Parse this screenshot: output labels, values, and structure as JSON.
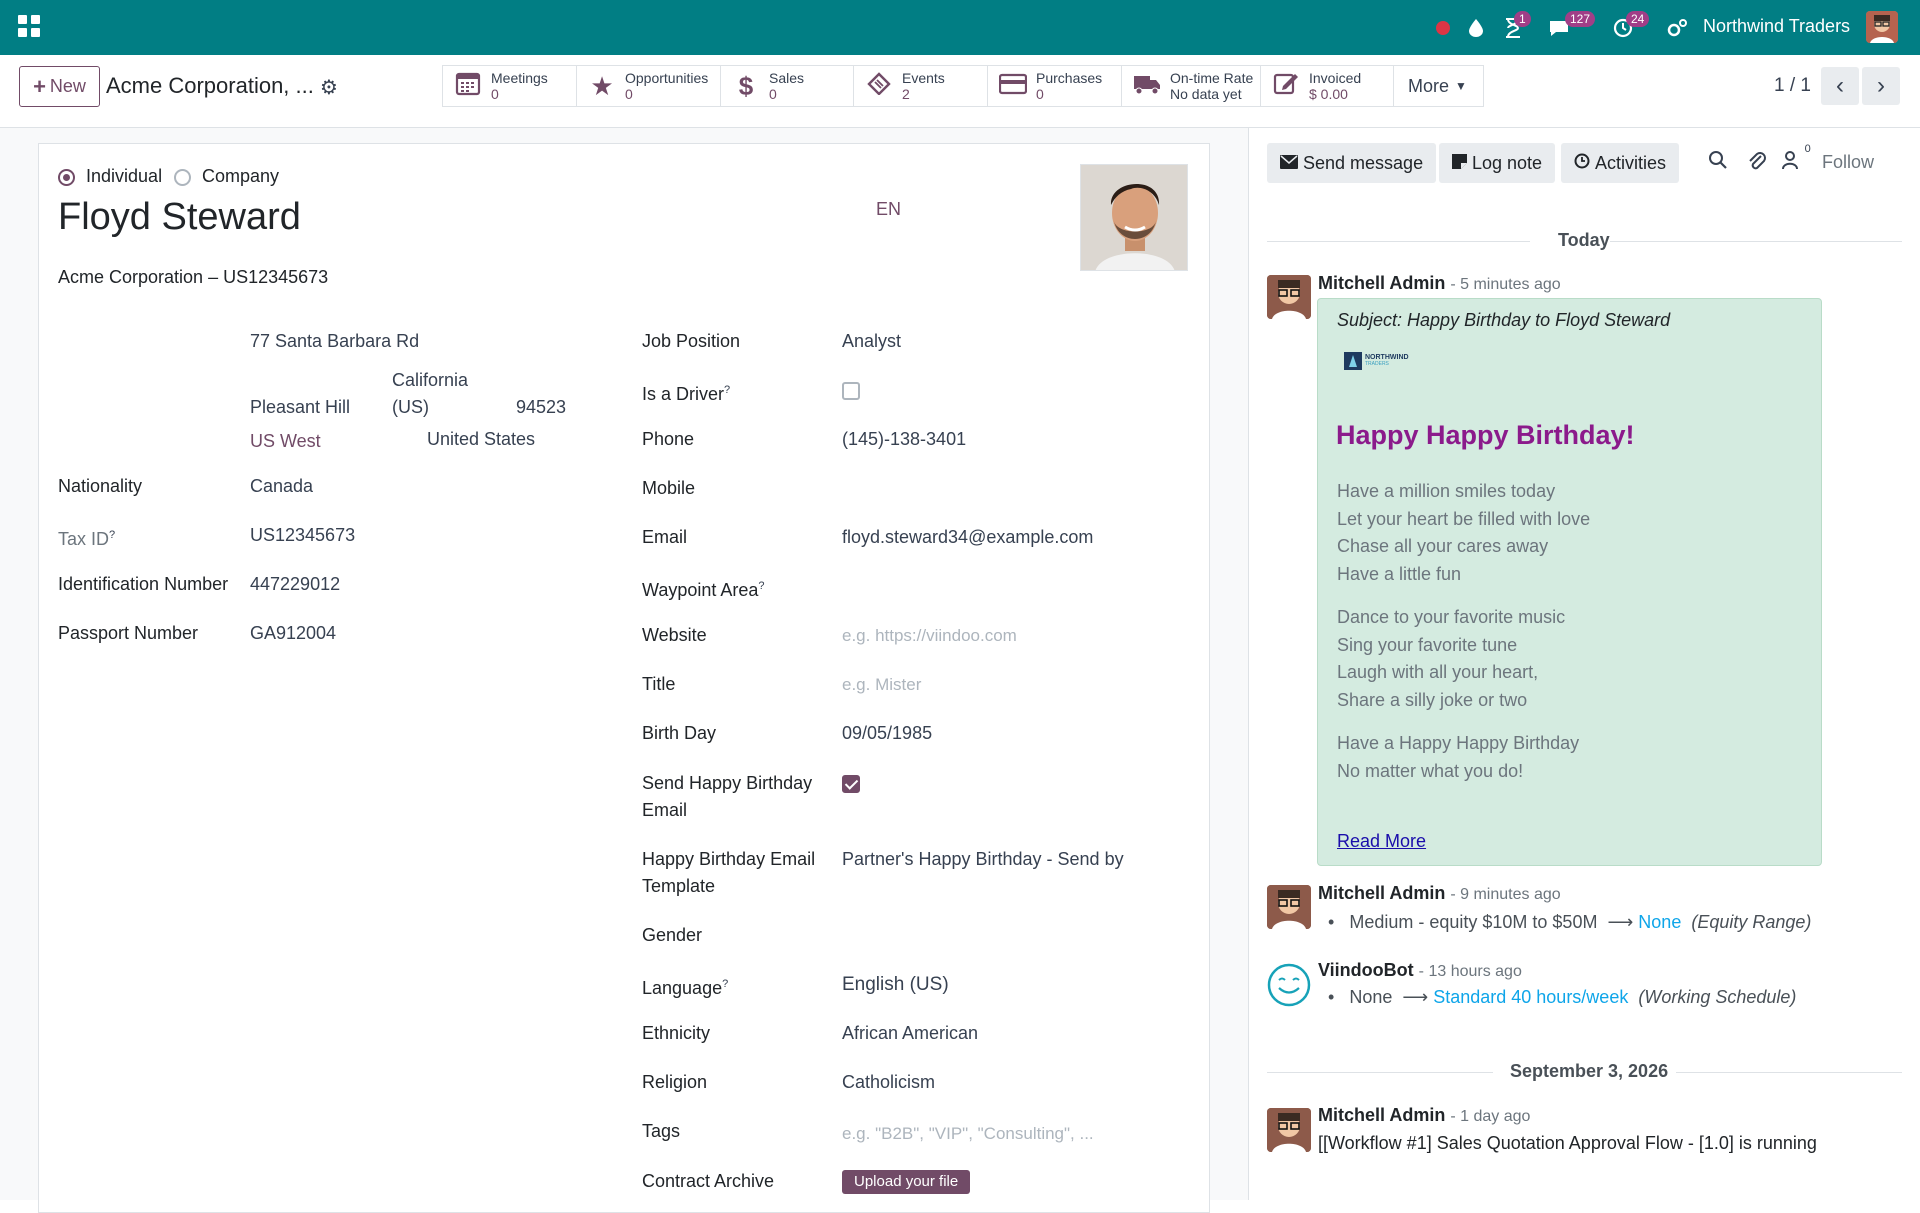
{
  "topbar": {
    "company_name": "Northwind Traders",
    "activities_count": "1",
    "messages_count": "127",
    "clock_count": "24"
  },
  "control": {
    "new_label": "New",
    "breadcrumb": "Acme Corporation, ...",
    "smart_buttons": [
      {
        "icon": "calendar-icon",
        "title": "Meetings",
        "value": "0"
      },
      {
        "icon": "star-icon",
        "title": "Opportunities",
        "value": "0"
      },
      {
        "icon": "dollar-icon",
        "title": "Sales",
        "value": "0"
      },
      {
        "icon": "ticket-icon",
        "title": "Events",
        "value": "2"
      },
      {
        "icon": "credit-card-icon",
        "title": "Purchases",
        "value": "0"
      },
      {
        "icon": "truck-icon",
        "title": "On-time Rate",
        "value": "No data yet"
      },
      {
        "icon": "invoice-icon",
        "title": "Invoiced",
        "value": "$ 0.00"
      }
    ],
    "more_label": "More",
    "pager": "1 / 1"
  },
  "form": {
    "type_individual": "Individual",
    "type_company": "Company",
    "type_selected": "Individual",
    "name": "Floyd Steward",
    "lang_badge": "EN",
    "parent": "Acme Corporation – US12345673",
    "address": {
      "street": "77 Santa Barbara Rd",
      "city": "Pleasant Hill",
      "state_line1": "California",
      "state_line2": "(US)",
      "zip": "94523",
      "region": "US West",
      "country": "United States"
    },
    "left_fields": [
      {
        "label": "Nationality",
        "value": "Canada"
      },
      {
        "label": "Tax ID",
        "value": "US12345673"
      },
      {
        "label": "Identification Number",
        "value": "447229012"
      },
      {
        "label": "Passport Number",
        "value": "GA912004"
      }
    ],
    "right": {
      "job_position_label": "Job Position",
      "job_position": "Analyst",
      "driver_label": "Is a Driver",
      "phone_label": "Phone",
      "phone": "(145)-138-3401",
      "mobile_label": "Mobile",
      "email_label": "Email",
      "email": "floyd.steward34@example.com",
      "waypoint_label": "Waypoint Area",
      "website_label": "Website",
      "website_placeholder": "e.g. https://viindoo.com",
      "title_label": "Title",
      "title_placeholder": "e.g. Mister",
      "birthday_label": "Birth Day",
      "birthday": "09/05/1985",
      "send_bday_label_1": "Send Happy Birthday",
      "send_bday_label_2": "Email",
      "bday_tmpl_label_1": "Happy Birthday Email",
      "bday_tmpl_label_2": "Template",
      "bday_tmpl": "Partner's Happy Birthday - Send by",
      "gender_label": "Gender",
      "language_label": "Language",
      "language": "English (US)",
      "ethnicity_label": "Ethnicity",
      "ethnicity": "African American",
      "religion_label": "Religion",
      "religion": "Catholicism",
      "tags_label": "Tags",
      "tags_placeholder": "e.g. \"B2B\", \"VIP\", \"Consulting\", ...",
      "contract_label": "Contract Archive",
      "upload_label": "Upload your file"
    },
    "is_driver": false,
    "send_bday": true
  },
  "chatter": {
    "send_message": "Send message",
    "log_note": "Log note",
    "activities": "Activities",
    "followers_count": "0",
    "follow": "Follow",
    "today": "Today",
    "msg1": {
      "author": "Mitchell Admin",
      "ago": "- 5 minutes ago",
      "subject": "Subject: Happy Birthday to Floyd Steward",
      "logo_text_1": "NORTHWIND",
      "logo_text_2": "TRADERS",
      "heading": "Happy Happy Birthday!",
      "stanza1": [
        "Have a million smiles today",
        "Let your heart be filled with love",
        "Chase all your cares away",
        "Have a little fun"
      ],
      "stanza2": [
        "Dance to your favorite music",
        "Sing your favorite tune",
        "Laugh with all your heart,",
        "Share a silly joke or two"
      ],
      "stanza3": [
        "Have a Happy Happy Birthday",
        "No matter what you do!"
      ],
      "read_more": "Read More"
    },
    "msg2": {
      "author": "Mitchell Admin",
      "ago": "- 9 minutes ago",
      "old": "Medium - equity $10M to $50M",
      "new": "None",
      "field": "(Equity Range)"
    },
    "msg3": {
      "author": "ViindooBot",
      "ago": "- 13 hours ago",
      "old": "None",
      "new": "Standard 40 hours/week",
      "field": "(Working Schedule)"
    },
    "date2": "September 3, 2026",
    "msg4": {
      "author": "Mitchell Admin",
      "ago": "- 1 day ago",
      "body": "[[Workflow #1] Sales Quotation Approval Flow - [1.0] is running"
    }
  }
}
